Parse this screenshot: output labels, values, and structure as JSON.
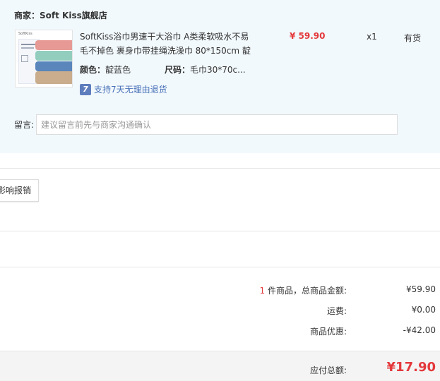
{
  "shop": {
    "label": "商家：",
    "name": "Soft Kiss旗舰店"
  },
  "product": {
    "thumb_brand": "SoftKiss",
    "title": "SoftKiss浴巾男速干大浴巾 A类柔软吸水不易毛不掉色 裹身巾带挂绳洗澡巾 80*150cm 靛",
    "price": "¥ 59.90",
    "quantity": "x1",
    "stock": "有货",
    "color_label": "颜色：",
    "color_value": "靛蓝色",
    "size_label": "尺码：",
    "size_value": "毛巾30*70c...",
    "return_icon": "7",
    "return_text": "支持7天无理由退货"
  },
  "message": {
    "label": "留言:",
    "placeholder": "建议留言前先与商家沟通确认"
  },
  "invoice": {
    "button_label": "影响报销"
  },
  "summary": {
    "count": "1",
    "count_suffix": " 件商品，总商品金额:",
    "total_value": "¥59.90",
    "shipping_label": "运费:",
    "shipping_value": "¥0.00",
    "discount_label": "商品优惠:",
    "discount_value": "-¥42.00",
    "payable_label": "应付总额:",
    "payable_value": "¥17.90"
  },
  "colors": {
    "accent_red": "#e4393c",
    "panel_bg": "#f2f9fd",
    "link_blue": "#4a72b8"
  }
}
